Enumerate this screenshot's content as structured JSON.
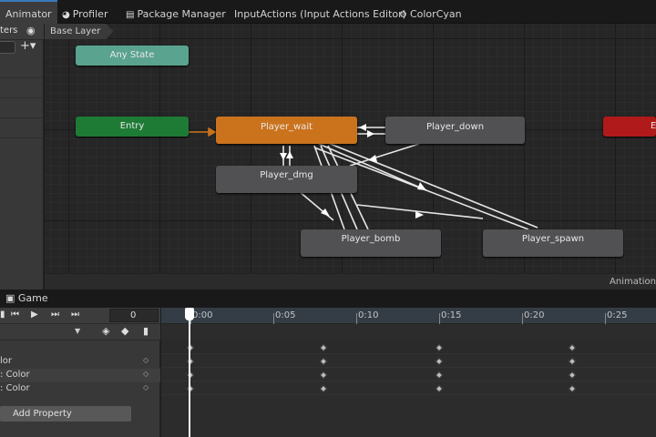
{
  "tabs": [
    {
      "label": "Animator",
      "icon": "animator-icon",
      "active": true
    },
    {
      "label": "Profiler",
      "icon": "profiler-icon"
    },
    {
      "label": "Package Manager",
      "icon": "package-icon"
    },
    {
      "label": "InputActions (Input Actions Editor)",
      "icon": ""
    },
    {
      "label": "ColorCyan",
      "icon": "inspector-object-icon"
    }
  ],
  "left_panel": {
    "tab_label": "ters",
    "eye_icon": "eye-icon",
    "add_icon": "plus-icon"
  },
  "graph": {
    "breadcrumb": "Base Layer",
    "footer_label": "Animation",
    "states": {
      "any_state": "Any State",
      "entry": "Entry",
      "exit": "E",
      "player_wait": "Player_wait",
      "player_down": "Player_down",
      "player_dmg": "Player_dmg",
      "player_bomb": "Player_bomb",
      "player_spawn": "Player_spawn"
    },
    "colors": {
      "any_state": "#5aa38f",
      "entry": "#1e7b35",
      "exit": "#b01a1a",
      "default_state": "#cb731c",
      "state": "#515153",
      "transition": "#e6e6e6",
      "entry_transition": "#cb731c"
    }
  },
  "bottom": {
    "game_tab": "Game",
    "game_icon": "gamepad-icon"
  },
  "animation": {
    "frame_value": "0",
    "timeline_ticks": [
      "0:00",
      "0:05",
      "0:10",
      "0:15",
      "0:20",
      "0:25"
    ],
    "properties": [
      {
        "label": "lor"
      },
      {
        "label": ": Color"
      },
      {
        "label": ": Color"
      }
    ],
    "add_property": "Add Property"
  }
}
